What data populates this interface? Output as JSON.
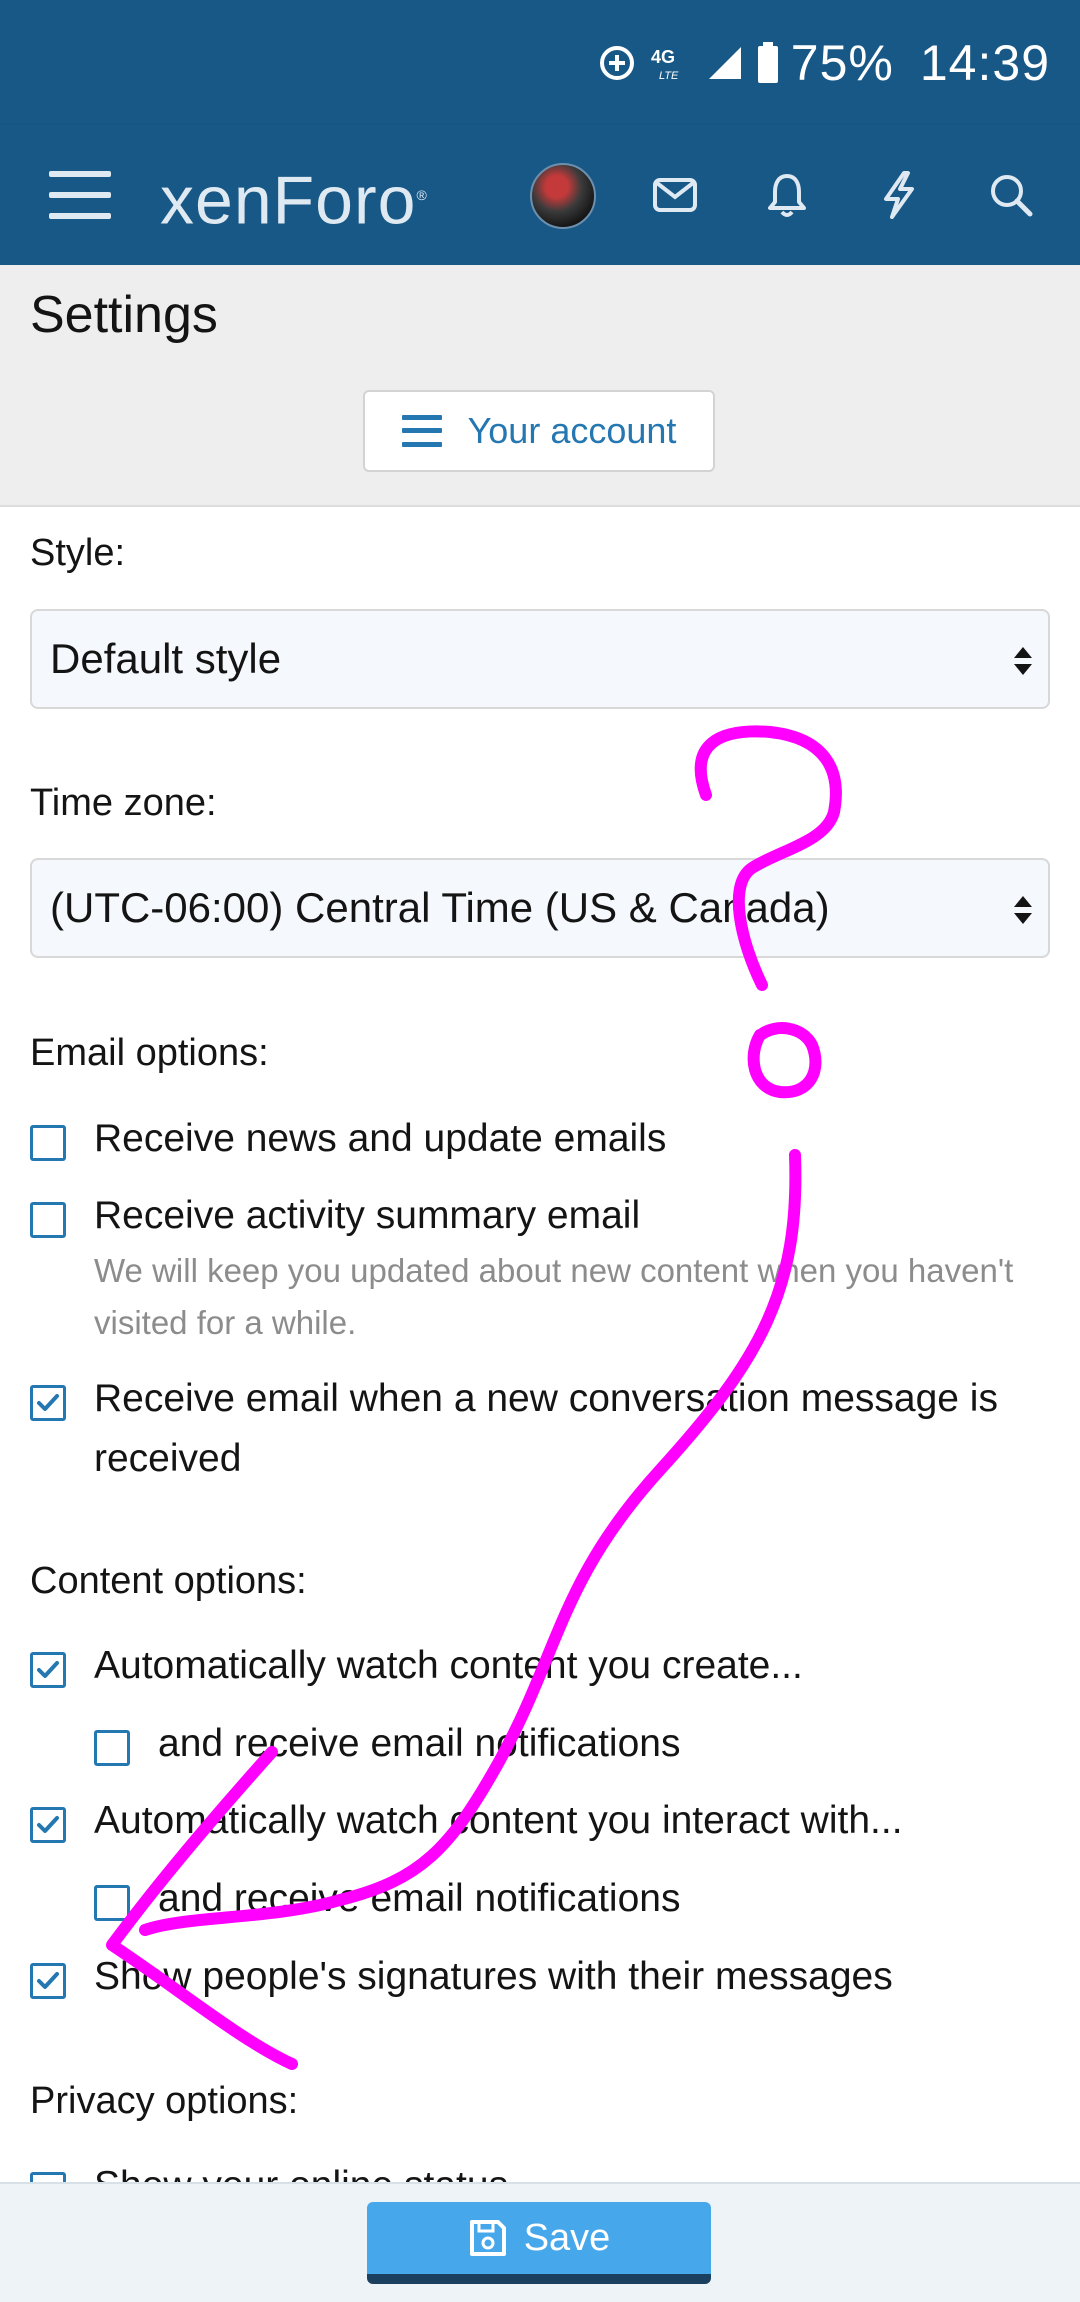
{
  "status_bar": {
    "battery": "75%",
    "time": "14:39",
    "network": "4G LTE"
  },
  "navbar": {
    "logo": "xenForo",
    "icons": [
      "menu-icon",
      "mail-icon",
      "bell-icon",
      "lightning-icon",
      "search-icon"
    ]
  },
  "page": {
    "title": "Settings",
    "account_button": "Your account"
  },
  "form": {
    "style_label": "Style:",
    "style_value": "Default style",
    "timezone_label": "Time zone:",
    "timezone_value": "(UTC-06:00) Central Time (US & Canada)",
    "email_label": "Email options:",
    "email_news": "Receive news and update emails",
    "email_summary": "Receive activity summary email",
    "email_summary_hint": "We will keep you updated about new content when you haven't visited for a while.",
    "email_conversation": "Receive email when a new conversation message is received",
    "content_label": "Content options:",
    "watch_create": "Automatically watch content you create...",
    "watch_create_email": "and receive email notifications",
    "watch_interact": "Automatically watch content you interact with...",
    "watch_interact_email": "and receive email notifications",
    "show_signatures": "Show people's signatures with their messages",
    "privacy_label": "Privacy options:",
    "online_status": "Show your online status"
  },
  "checkbox_states": {
    "email_news": false,
    "email_summary": false,
    "email_conversation": true,
    "watch_create": true,
    "watch_create_email": false,
    "watch_interact": true,
    "watch_interact_email": false,
    "show_signatures": true,
    "online_status": false
  },
  "footer": {
    "save_label": "Save"
  },
  "colors": {
    "header": "#185886",
    "accent": "#2577b1",
    "save_button": "#47a7eb",
    "annotation": "#ff00ff"
  }
}
